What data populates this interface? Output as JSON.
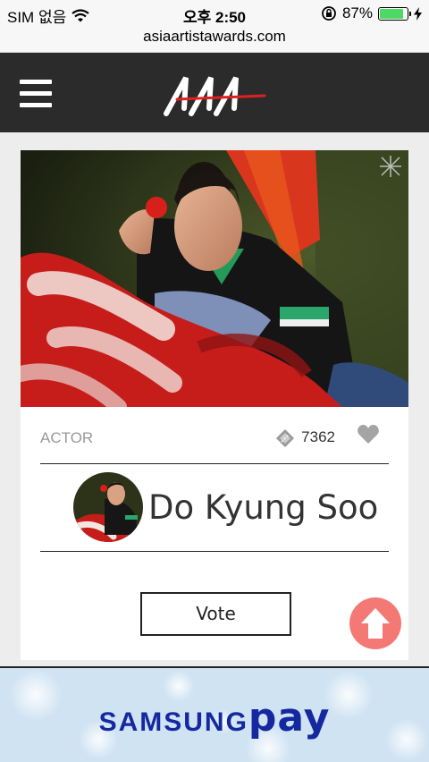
{
  "status_bar": {
    "carrier": "SIM 없음",
    "time": "오후 2:50",
    "battery_percent": "87%",
    "battery_level": 0.87
  },
  "url_bar": {
    "url": "asiaartistawards.com"
  },
  "header": {
    "menu_icon": "hamburger-menu-icon",
    "logo_icon": "aaa-logo"
  },
  "card": {
    "category": "ACTOR",
    "vote_count": "7362",
    "ticket_icon": "ticket-icon",
    "heart_icon": "heart-icon",
    "artist_name": "Do Kyung Soo",
    "vote_label": "Vote"
  },
  "scroll_top": {
    "icon": "arrow-up-icon"
  },
  "banner": {
    "brand": "SAMSUNG",
    "product": "pay"
  },
  "colors": {
    "header_bg": "#2b2b2b",
    "scroll_top": "#f46e6a",
    "banner_text": "#1428a0",
    "battery": "#4cd964"
  }
}
